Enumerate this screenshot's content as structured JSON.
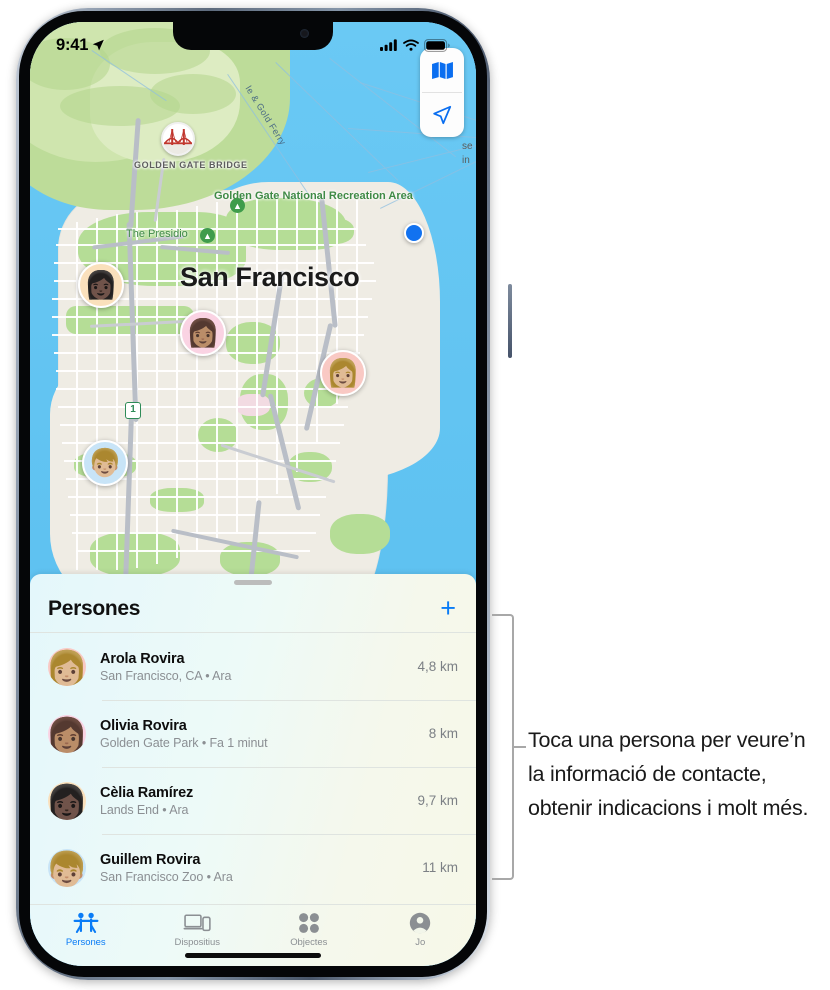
{
  "status_bar": {
    "time": "9:41",
    "location_arrow_icon": "location-arrow-icon",
    "cellular_icon": "cellular-bars-icon",
    "wifi_icon": "wifi-icon",
    "battery_icon": "battery-full-icon"
  },
  "map": {
    "city_label": "San Francisco",
    "bridge_label": "GOLDEN GATE BRIDGE",
    "recreation_label": "Golden Gate National Recreation Area",
    "presidio_label": "The Presidio",
    "ferry_label": "le & Gold Ferry",
    "treasure_island_label": "se\nin",
    "highway_shield": "1",
    "controls": {
      "layers_icon": "map-layers-icon",
      "locate_icon": "locate-me-arrow-icon"
    },
    "user_location_icon": "user-location-dot-icon",
    "colors": {
      "water": "#5fc2f1",
      "land": "#efece4",
      "park": "#b5dd96",
      "accent_blue": "#0a7cf6"
    },
    "pins": [
      {
        "name": "Cèlia Ramírez",
        "bg": "#fae0bc",
        "glyph": "👩🏿‍🦳"
      },
      {
        "name": "Olivia Rovira",
        "bg": "#fad3e3",
        "glyph": "👩🏽"
      },
      {
        "name": "Arola Rovira",
        "bg": "#f9c9c4",
        "glyph": "👩🏼"
      },
      {
        "name": "Guillem Rovira",
        "bg": "#c8e4f7",
        "glyph": "👦🏼"
      }
    ]
  },
  "sheet": {
    "title": "Persones",
    "add_label": "+",
    "people": [
      {
        "name": "Arola Rovira",
        "subtitle": "San Francisco, CA • Ara",
        "distance": "4,8 km",
        "bg": "#f9c9c4",
        "glyph": "👩🏼"
      },
      {
        "name": "Olivia Rovira",
        "subtitle": "Golden Gate Park • Fa 1 minut",
        "distance": "8 km",
        "bg": "#fad3e3",
        "glyph": "👩🏽"
      },
      {
        "name": "Cèlia Ramírez",
        "subtitle": "Lands End • Ara",
        "distance": "9,7 km",
        "bg": "#fae0bc",
        "glyph": "👩🏿‍🦳"
      },
      {
        "name": "Guillem Rovira",
        "subtitle": "San Francisco Zoo • Ara",
        "distance": "11 km",
        "bg": "#c8e4f7",
        "glyph": "👦🏼"
      }
    ]
  },
  "tab_bar": {
    "tabs": [
      {
        "label": "Persones",
        "icon": "people-icon",
        "active": true
      },
      {
        "label": "Dispositius",
        "icon": "devices-icon",
        "active": false
      },
      {
        "label": "Objectes",
        "icon": "items-icon",
        "active": false
      },
      {
        "label": "Jo",
        "icon": "person-circle-icon",
        "active": false
      }
    ]
  },
  "callout": {
    "text": "Toca una persona per veure’n la informació de contacte, obtenir indicacions i molt més."
  }
}
